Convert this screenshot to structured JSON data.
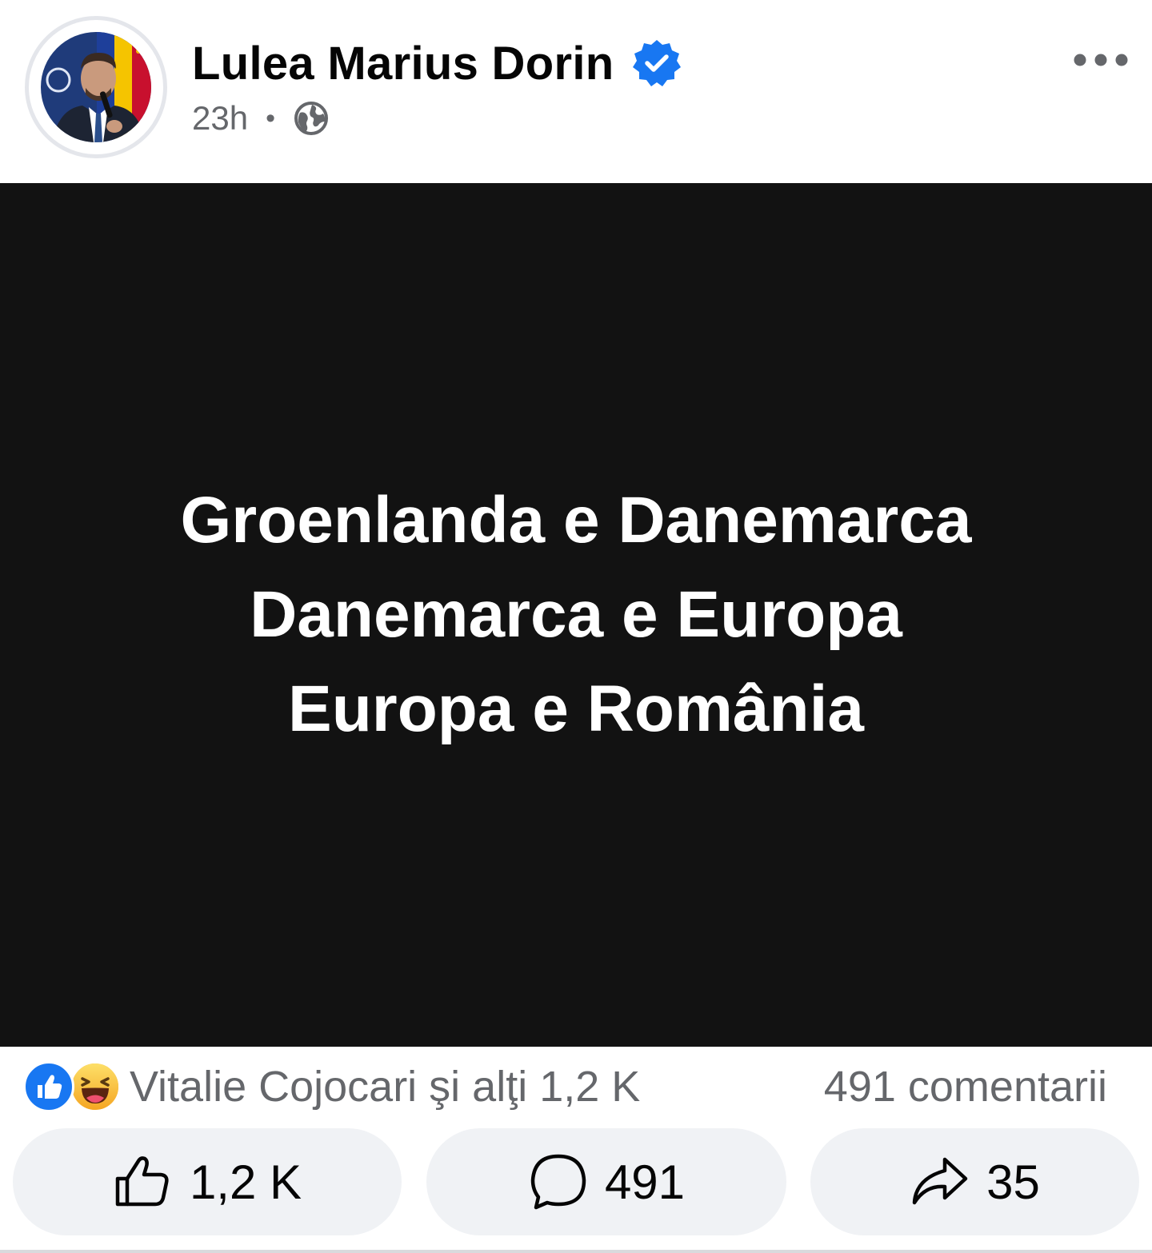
{
  "post": {
    "author": {
      "name": "Lulea Marius Dorin",
      "verified_icon": "verified-badge-icon",
      "avatar_icon": "profile-photo"
    },
    "timestamp": "23h",
    "separator": "•",
    "audience_icon": "globe-icon",
    "image_text": {
      "line1": "Groenlanda e Danemarca",
      "line2": "Danemarca e Europa",
      "line3": "Europa e România"
    },
    "reactions": {
      "icons": [
        "like-reaction-icon",
        "haha-reaction-icon"
      ],
      "summary": "Vitalie Cojocari şi alţi 1,2 K",
      "comments_summary": "491 comentarii"
    },
    "actions": {
      "like_count": "1,2 K",
      "comment_count": "491",
      "share_count": "35"
    }
  },
  "colors": {
    "verified_blue": "#1877f2",
    "secondary_text": "#65676b",
    "image_background": "#121212",
    "button_background": "#f0f2f5"
  }
}
